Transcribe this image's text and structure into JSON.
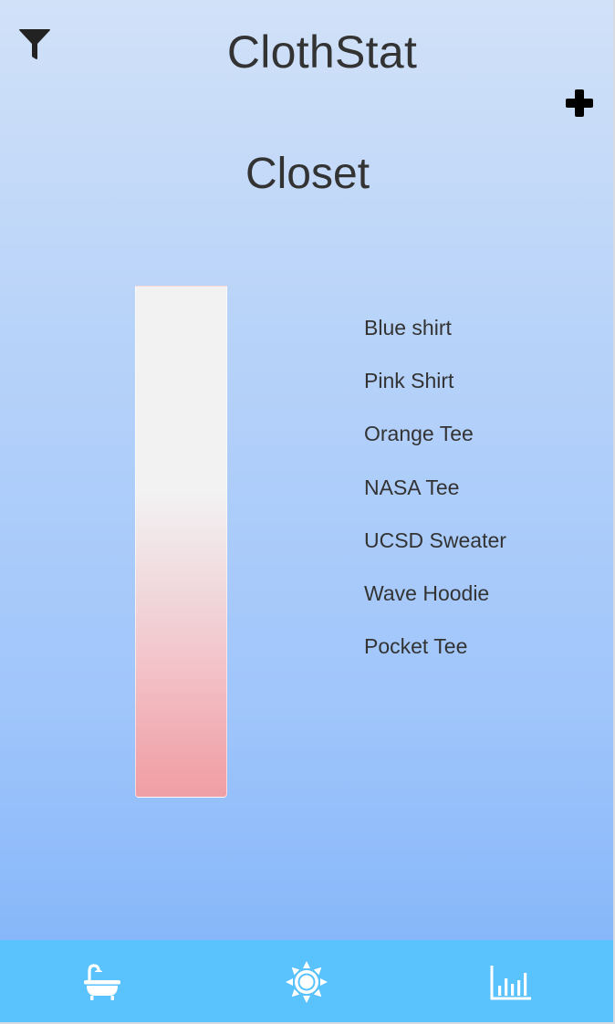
{
  "header": {
    "title": "ClothStat",
    "filter_icon": "filter-icon",
    "add_icon": "plus-icon"
  },
  "page": {
    "title": "Closet"
  },
  "meter": {
    "top_color": "#f2f2f3",
    "bottom_color": "#ef9fa6"
  },
  "closet": {
    "items": [
      "Blue shirt",
      "Pink Shirt",
      "Orange Tee",
      "NASA Tee",
      "UCSD Sweater",
      "Wave Hoodie",
      "Pocket Tee"
    ]
  },
  "bottom_nav": {
    "background": "#5ac2fc",
    "items": [
      {
        "icon": "bathtub-icon"
      },
      {
        "icon": "sun-icon"
      },
      {
        "icon": "bar-chart-icon"
      }
    ]
  }
}
